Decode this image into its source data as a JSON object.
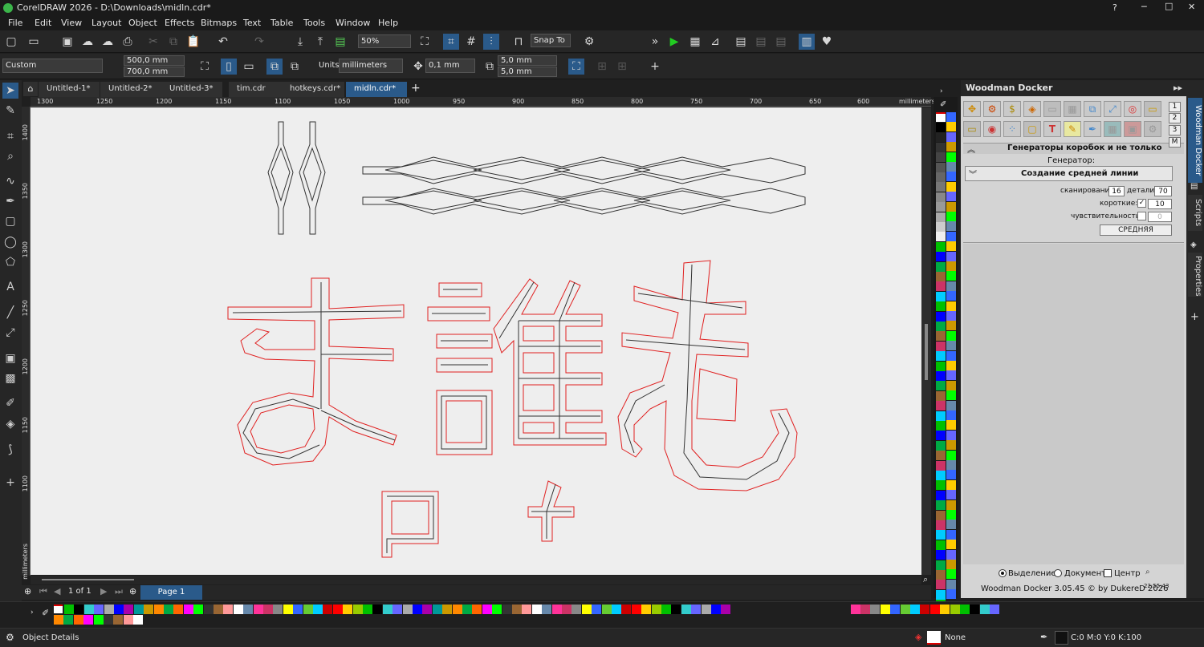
{
  "title": "CorelDRAW 2026 - D:\\Downloads\\midln.cdr*",
  "window_controls": {
    "help": "?",
    "minimize": "─",
    "maximize": "□",
    "close": "✕"
  },
  "menu": [
    "File",
    "Edit",
    "View",
    "Layout",
    "Object",
    "Effects",
    "Bitmaps",
    "Text",
    "Table",
    "Tools",
    "Window",
    "Help"
  ],
  "toolbar1": {
    "zoom": "50%",
    "snap_to": "Snap To"
  },
  "toolbar2": {
    "preset": "Custom",
    "width": "500,0 mm",
    "height": "700,0 mm",
    "units_label": "Units:",
    "units": "millimeters",
    "nudge": "0,1 mm",
    "dup_x": "5,0 mm",
    "dup_y": "5,0 mm"
  },
  "tabs": [
    "Untitled-1*",
    "Untitled-2*",
    "Untitled-3*",
    "tim.cdr",
    "hotkeys.cdr*",
    "midln.cdr*"
  ],
  "active_tab": "midln.cdr*",
  "ruler": {
    "h_labels": [
      "1300",
      "1250",
      "1200",
      "1150",
      "1100",
      "1050",
      "1000",
      "950",
      "900",
      "850",
      "800",
      "750",
      "700",
      "650",
      "600"
    ],
    "unit": "millimeters",
    "v_labels": [
      "1400",
      "1350",
      "1300",
      "1250",
      "1200",
      "1150",
      "1100"
    ],
    "v_unit": "millimeters"
  },
  "pagebar": {
    "page_count": "1 of 1",
    "page_tab": "Page 1"
  },
  "docker": {
    "title": "Woodman Docker",
    "section_title": "Генераторы коробок и не только",
    "generator_label": "Генератор:",
    "generator_value": "Создание средней линии",
    "scan_label": "сканирование:",
    "scan_value": "16",
    "detail_label": "детали:",
    "detail_value": "70",
    "short_label": "короткие:",
    "short_value": "10",
    "sens_label": "чувствительность:",
    "sens_value": "0",
    "run_button": "СРЕДНЯЯ",
    "radio_selection": "Выделение",
    "radio_document": "Документ",
    "center_label": "Центр",
    "footer": "Woodman Docker 3.05.45 © by DukereD 2026",
    "time": "22:55:43",
    "num_buttons": [
      "1",
      "2",
      "3",
      "M"
    ]
  },
  "side_tabs": [
    "Woodman Docker",
    "Scripts",
    "Properties"
  ],
  "status": {
    "left": "Object Details",
    "fill": "None",
    "outline": "C:0 M:0 Y:0 K:100"
  },
  "colors": {
    "accent": "#2a5a8a",
    "canvas": "#eeeeee",
    "outline_red": "#e02020",
    "outline_dark": "#333333"
  }
}
